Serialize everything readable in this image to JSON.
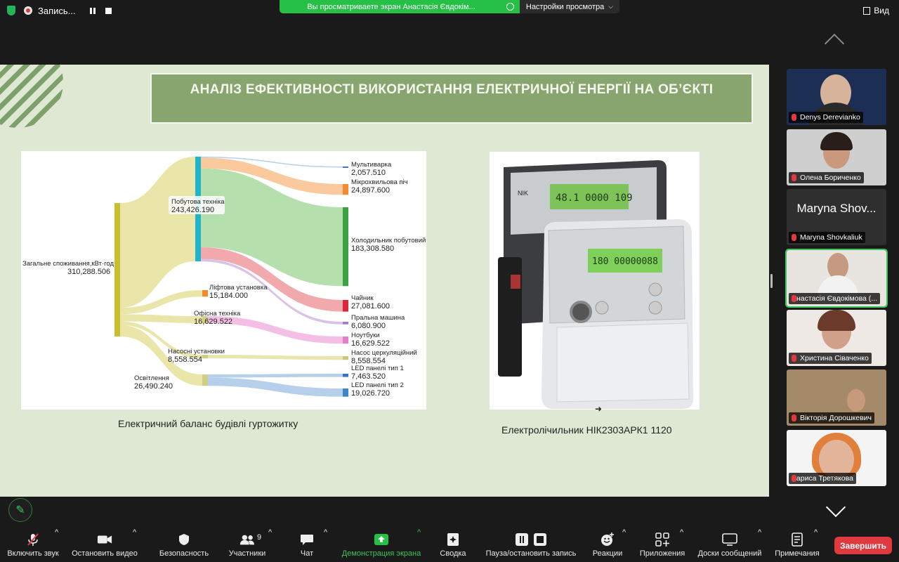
{
  "recording": {
    "label": "Запись..."
  },
  "share_banner": {
    "text": "Вы просматриваете экран Анастасія Євдокім..."
  },
  "view_options": {
    "label": "Настройки просмотра"
  },
  "view_button": {
    "label": "Вид"
  },
  "slide": {
    "title": "АНАЛІЗ ЕФЕКТИВНОСТІ ВИКОРИСТАННЯ ЕЛЕКТРИЧНОЇ ЕНЕРГІЇ НА ОБ’ЄКТІ",
    "sankey_caption": "Електричний баланс будівлі гуртожитку",
    "meter_caption": "Електролічильник НІК2303АРК1 1120"
  },
  "chart_data": {
    "type": "sankey",
    "unit": "кВт·год",
    "nodes": [
      {
        "name": "Загальне споживання,кВт·год",
        "value": "310,288.506"
      },
      {
        "name": "Побутова техніка",
        "value": "243,426.190"
      },
      {
        "name": "Ліфтова установка",
        "value": "15,184.000"
      },
      {
        "name": "Офісна техніка",
        "value": "16,629.522"
      },
      {
        "name": "Насосні установки",
        "value": "8,558.554"
      },
      {
        "name": "Освітлення",
        "value": "26,490.240"
      },
      {
        "name": "Мультиварка",
        "value": "2,057.510"
      },
      {
        "name": "Мікрохвильова піч",
        "value": "24,897.600"
      },
      {
        "name": "Холодильник побутовий",
        "value": "183,308.580"
      },
      {
        "name": "Чайник",
        "value": "27,081.600"
      },
      {
        "name": "Пральна машина",
        "value": "6,080.900"
      },
      {
        "name": "Ноутбуки",
        "value": "16,629.522"
      },
      {
        "name": "Насос церкуляційний",
        "value": "8,558.554"
      },
      {
        "name": "LED панелі тип 1",
        "value": "7,463.520"
      },
      {
        "name": "LED панелі тип 2",
        "value": "19,026.720"
      }
    ],
    "links": [
      {
        "source": "Загальне споживання,кВт·год",
        "target": "Побутова техніка",
        "value": 243426.19
      },
      {
        "source": "Загальне споживання,кВт·год",
        "target": "Ліфтова установка",
        "value": 15184.0
      },
      {
        "source": "Загальне споживання,кВт·год",
        "target": "Офісна техніка",
        "value": 16629.522
      },
      {
        "source": "Загальне споживання,кВт·год",
        "target": "Насосні установки",
        "value": 8558.554
      },
      {
        "source": "Загальне споживання,кВт·год",
        "target": "Освітлення",
        "value": 26490.24
      },
      {
        "source": "Побутова техніка",
        "target": "Мультиварка",
        "value": 2057.51
      },
      {
        "source": "Побутова техніка",
        "target": "Мікрохвильова піч",
        "value": 24897.6
      },
      {
        "source": "Побутова техніка",
        "target": "Холодильник побутовий",
        "value": 183308.58
      },
      {
        "source": "Побутова техніка",
        "target": "Чайник",
        "value": 27081.6
      },
      {
        "source": "Побутова техніка",
        "target": "Пральна машина",
        "value": 6080.9
      },
      {
        "source": "Офісна техніка",
        "target": "Ноутбуки",
        "value": 16629.522
      },
      {
        "source": "Насосні установки",
        "target": "Насос церкуляційний",
        "value": 8558.554
      },
      {
        "source": "Освітлення",
        "target": "LED панелі тип 1",
        "value": 7463.52
      },
      {
        "source": "Освітлення",
        "target": "LED панелі тип 2",
        "value": 19026.72
      }
    ]
  },
  "participants": [
    {
      "name": "Denys Derevianko",
      "muted": true
    },
    {
      "name": "Олена Бориченко",
      "muted": true
    },
    {
      "name": "Maryna Shovkaliuk",
      "display": "Maryna Shov...",
      "muted": true
    },
    {
      "name": "Анастасія Євдокімова (...",
      "muted": false,
      "active": true
    },
    {
      "name": "Христина Сіваченко",
      "muted": true
    },
    {
      "name": "Вікторія Дорошкевич",
      "muted": true
    },
    {
      "name": "Лариса Третякова",
      "muted": false
    }
  ],
  "toolbar": {
    "audio": "Включить звук",
    "video": "Остановить видео",
    "security": "Безопасность",
    "participants": "Участники",
    "participants_count": "9",
    "chat": "Чат",
    "share": "Демонстрация экрана",
    "summary": "Сводка",
    "record": "Пауза/остановить запись",
    "reactions": "Реакции",
    "apps": "Приложения",
    "whiteboards": "Доски сообщений",
    "notes": "Примечания",
    "end": "Завершить"
  },
  "colors": {
    "accent_green": "#27c046",
    "end_red": "#e0393e",
    "slide_bg": "#dfe8d2",
    "title_bg": "#89a56f"
  },
  "icons": [
    "shield-icon",
    "record-icon",
    "pause-icon",
    "stop-icon",
    "mic-muted-icon",
    "camera-icon",
    "shield-security-icon",
    "people-icon",
    "chat-icon",
    "share-arrow-icon",
    "summary-icon",
    "pause-record-icon",
    "reaction-icon",
    "apps-icon",
    "whiteboard-icon",
    "notes-icon",
    "pen-icon",
    "chevron-up-icon",
    "chevron-down-icon"
  ]
}
